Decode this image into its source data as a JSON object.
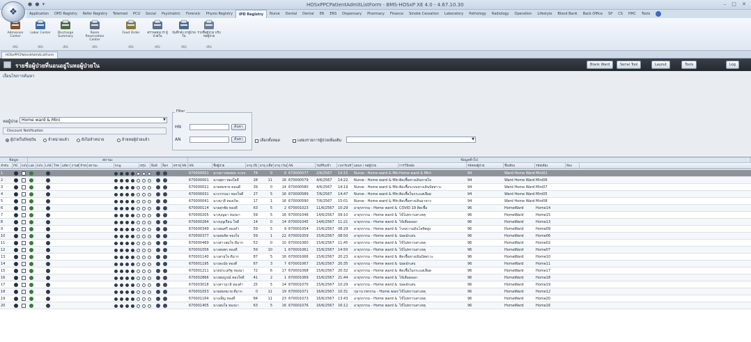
{
  "window": {
    "title": "HOSxPPCPatientAdmitListForm - BMS-HOSxP XE 4.0 - 4.67.10.30",
    "orb_symbol": "❖",
    "controls": "– □ ✕",
    "qat": "● ● ▾"
  },
  "ribbon": {
    "tabs": [
      "Application",
      "OPD Registry",
      "Refer Registry",
      "Telemed",
      "PCU",
      "Social",
      "Psychiatric",
      "Forensic",
      "Physio Registry",
      "IPD Registry",
      "Nurse",
      "Dental",
      "Dental",
      "ER",
      "ERS",
      "Dispensary",
      "Pharmacy",
      "Finance",
      "Smoke Cessation",
      "Laboratory",
      "Pathology",
      "Radiology",
      "Operation",
      "Lifestyle",
      "Blood Bank",
      "Back Office",
      "SP",
      "CS",
      "HHC",
      "Tools"
    ],
    "active_tab_index": 9,
    "buttons": [
      {
        "label": "Admission Center",
        "icon": "bed-icon",
        "group": "IPD"
      },
      {
        "label": "Labor Center",
        "icon": "labor-icon",
        "group": "IPD"
      },
      {
        "label": "Discharge Summary",
        "icon": "discharge-icon",
        "group": "IPD"
      },
      {
        "label": "Room Reservation Center",
        "icon": "room-icon",
        "group": "IPD"
      },
      {
        "label": "Food Order",
        "icon": "food-icon",
        "group": "IPD"
      },
      {
        "label": "ตรวจสอบเวร ผู้ป่วยใน",
        "icon": "check-icon",
        "group": "IPD"
      },
      {
        "label": "บันทึกสั่ง ยาผู้ป่วยใน",
        "icon": "order-icon",
        "group": "IPD"
      },
      {
        "label": "รายชื่อผู้ป่วย ปรับหอผู้ป่วย",
        "icon": "list-icon",
        "group": "IPD"
      }
    ]
  },
  "doc_tab": {
    "label": "HOSxPPCPatientAdmitListForm"
  },
  "header": {
    "title": "รายชื่อผู้ป่วยที่นอนอยู่ในหอผู้ป่วยใน",
    "buttons": [
      "Blank Ward",
      "Serial Tool",
      "Layout",
      "Tools",
      "Log"
    ]
  },
  "section_label": "เงื่อนไขการค้นหา",
  "filters": {
    "ward_label": "หอผู้ป่วย",
    "ward_value": "Home ward & Mini",
    "tools_title": "Filter",
    "hn_label": "HN",
    "an_label": "AN",
    "search_btn": "ค้นหา",
    "display_group_title": "Discount Notification",
    "radios": [
      "ผู้ป่วยในปัจจุบัน",
      "จำหน่ายแล้ว",
      "ยังไม่จำหน่าย",
      "ย้ายหอผู้ป่วยแล้ว"
    ],
    "radio_selected": 0,
    "check_label": "เลือกทั้งหมด",
    "check2_label": "แสดงรายการผู้ป่วยเพิ่มเติม"
  },
  "grid": {
    "bands": [
      {
        "label": "ข้อมูล"
      },
      {
        "label": "สถานะ"
      },
      {
        "label": "ข้อมูลทั่วไป"
      }
    ],
    "columns": [
      "ลำดับ",
      "PIC",
      "Info",
      "Lab",
      "Info",
      "LAB",
      "โรค",
      "แพ้ยา",
      "งานสังคม",
      "จำหน่าย",
      "สถานะ",
      "Img",
      "สรุป",
      "พิมพ์",
      "ล็อก",
      "ตรวจ",
      "AN",
      "HN",
      "ชื่อผู้ป่วย",
      "อายุ (ปี)",
      "อายุ (เดือน)",
      "อายุ (วัน)",
      "AN",
      "วันที่รับเข้า",
      "เวลารับเข้า",
      "แผนก / หอผู้ป่วย",
      "การวินิจฉัย",
      "รหัสหอผู้ป่วย",
      "ชื่อเตียง",
      "รหัสเตียง",
      "ห้อง"
    ],
    "rows": [
      {
        "no": "1",
        "hn": "670000001",
        "name": "นางสาวทดสอบ ระบบ",
        "y": "74",
        "m": "0",
        "d": "0",
        "an": "670000577",
        "date": "2/6/2567",
        "time": "14:15",
        "ward": "Nurse - Home ward & Mini",
        "dx": "Home ward & Mini",
        "wcode": "94",
        "bed": "Ward Home Ward",
        "bcode": "Mini01",
        "sel": true
      },
      {
        "no": "2",
        "hn": "670000001",
        "name": "นางสุดา ทองใจดี",
        "y": "28",
        "m": "11",
        "d": "16",
        "an": "670000579",
        "date": "4/6/2567",
        "time": "14:22",
        "ward": "Nurse - Home ward & Mini",
        "dx": "ติดเชื้อทางเดินหายใจ",
        "wcode": "94",
        "bed": "Ward Home Ward",
        "bcode": "Mini06"
      },
      {
        "no": "3",
        "hn": "670000021",
        "name": "นายสมชาย ดอนดี",
        "y": "39",
        "m": "0",
        "d": "14",
        "an": "670000580",
        "date": "4/6/2567",
        "time": "14:19",
        "ward": "Nurse - Home ward & Mini",
        "dx": "ติดเชื้อระบบทางเดินปัสสาวะ",
        "wcode": "94",
        "bed": "Ward Home Ward",
        "bcode": "Mini07"
      },
      {
        "no": "4",
        "hn": "670000031",
        "name": "นางวรรณา ทองใจดี",
        "y": "27",
        "m": "5",
        "d": "16",
        "an": "670000589",
        "date": "7/6/2567",
        "time": "14:47",
        "ward": "Nurse - Home ward & Mini",
        "dx": "ติดเชื้อในกระแสเลือด",
        "wcode": "94",
        "bed": "Ward Home Ward",
        "bcode": "Mini05"
      },
      {
        "no": "5",
        "hn": "670000041",
        "name": "นางมาลี ทองเกิด",
        "y": "17",
        "m": "1",
        "d": "16",
        "an": "670000590",
        "date": "7/6/2567",
        "time": "15:01",
        "ward": "Nurse - Home ward & Mini",
        "dx": "ติดเชื้อทางเดินอาหาร",
        "wcode": "94",
        "bed": "Ward Home Ward",
        "bcode": "Mini08"
      },
      {
        "no": "6",
        "hn": "670000114",
        "name": "นายสุรชัย ทองดี",
        "y": "63",
        "m": "5",
        "d": "2",
        "an": "670001023",
        "date": "11/6/2567",
        "time": "10:29",
        "ward": "อายุรกรรม - Home ward & Mini",
        "dx": "COVID 19 ติดเชื้อ",
        "wcode": "96",
        "bed": "HomeWard",
        "bcode": "Home14"
      },
      {
        "no": "7",
        "hn": "670000205",
        "name": "นางบุญมา ทองมา",
        "y": "59",
        "m": "5",
        "d": "16",
        "an": "670001046",
        "date": "14/6/2567",
        "time": "09:10",
        "ward": "อายุรกรรม - Home ward & Mini",
        "dx": "ไข้ไม่ทราบสาเหตุ",
        "wcode": "96",
        "bed": "HomeWard",
        "bcode": "Home15"
      },
      {
        "no": "8",
        "hn": "670000264",
        "name": "นางบุญเรือน ใจดี",
        "y": "14",
        "m": "0",
        "d": "14",
        "an": "670001045",
        "date": "14/6/2567",
        "time": "11:21",
        "ward": "อายุรกรรม - Home ward & Mini",
        "dx": "ไข้เลือดออก",
        "wcode": "96",
        "bed": "HomeWard",
        "bcode": "Home13"
      },
      {
        "no": "9",
        "hn": "670000349",
        "name": "นางสมศรี ทองคำ",
        "y": "59",
        "m": "5",
        "d": "9",
        "an": "670001054",
        "date": "15/6/2567",
        "time": "08:29",
        "ward": "อายุรกรรม - Home ward & Mini",
        "dx": "โรคความดันโลหิตสูง",
        "wcode": "96",
        "bed": "HomeWard",
        "bcode": "Home09"
      },
      {
        "no": "10",
        "hn": "670000377",
        "name": "นายสมจิต ทองใจ",
        "y": "59",
        "m": "1",
        "d": "22",
        "an": "670001059",
        "date": "15/6/2567",
        "time": "08:50",
        "ward": "อายุรกรรม - Home ward & Mini",
        "dx": "ปอดอักเสบ",
        "wcode": "96",
        "bed": "HomeWard",
        "bcode": "Home06"
      },
      {
        "no": "11",
        "hn": "670000469",
        "name": "นางสาวสมใจ ดีมาก",
        "y": "53",
        "m": "0",
        "d": "10",
        "an": "670001060",
        "date": "15/6/2567",
        "time": "11:45",
        "ward": "อายุรกรรม - Home ward & Mini",
        "dx": "ไข้ไม่ทราบสาเหตุ",
        "wcode": "96",
        "bed": "HomeWard",
        "bcode": "Home02"
      },
      {
        "no": "12",
        "hn": "670001056",
        "name": "นางสมพร ทองดี",
        "y": "59",
        "m": "10",
        "d": "1",
        "an": "670001061",
        "date": "15/6/2567",
        "time": "14:50",
        "ward": "อายุรกรรม - Home ward & Mini",
        "dx": "ไข้ไม่ทราบสาเหตุ",
        "wcode": "96",
        "bed": "HomeWard",
        "bcode": "Home07"
      },
      {
        "no": "13",
        "hn": "670001140",
        "name": "นางสายใจ ดีมาก",
        "y": "87",
        "m": "5",
        "d": "16",
        "an": "670001066",
        "date": "15/6/2567",
        "time": "20:23",
        "ward": "อายุรกรรม - Home ward & Mini",
        "dx": "ติดเชื้อทางเดินปัสสาวะ",
        "wcode": "96",
        "bed": "HomeWard",
        "bcode": "Home10"
      },
      {
        "no": "14",
        "hn": "670001195",
        "name": "นางละมัย ทองดี",
        "y": "67",
        "m": "3",
        "d": "7",
        "an": "670001067",
        "date": "15/6/2567",
        "time": "20:35",
        "ward": "อายุรกรรม - Home ward & Mini",
        "dx": "ปอดอักเสบ",
        "wcode": "96",
        "bed": "HomeWard",
        "bcode": "Home11"
      },
      {
        "no": "15",
        "hn": "670001211",
        "name": "นายประเสริฐ ทองมา",
        "y": "72",
        "m": "6",
        "d": "17",
        "an": "670001068",
        "date": "15/6/2567",
        "time": "20:32",
        "ward": "อายุรกรรม - Home ward & Mini",
        "dx": "ติดเชื้อในกระแสเลือด",
        "wcode": "96",
        "bed": "HomeWard",
        "bcode": "Home17"
      },
      {
        "no": "16",
        "hn": "670002866",
        "name": "นางสมบูรณ์ ทองใจดี",
        "y": "41",
        "m": "2",
        "d": "1",
        "an": "670001069",
        "date": "15/6/2567",
        "time": "21:44",
        "ward": "อายุรกรรม - Home ward & Mini",
        "dx": "ไข้เลือดออก",
        "wcode": "96",
        "bed": "HomeWard",
        "bcode": "Home18"
      },
      {
        "no": "17",
        "hn": "670003018",
        "name": "นางสาวมาลี ทองคำ",
        "y": "25",
        "m": "5",
        "d": "14",
        "an": "670001070",
        "date": "15/6/2567",
        "time": "10:29",
        "ward": "อายุรกรรม - Home ward & Mini",
        "dx": "ปอดอักเสบ",
        "wcode": "96",
        "bed": "HomeWard",
        "bcode": "Home19"
      },
      {
        "no": "18",
        "hn": "670001053",
        "name": "นายสมหมาย ดีมาก",
        "y": "0",
        "m": "11",
        "d": "19",
        "an": "670001071",
        "date": "16/6/2567",
        "time": "10:31",
        "ward": "กุมารเวชกรรม - Home ward & Mini",
        "dx": "ไข้ไม่ทราบสาเหตุ",
        "wcode": "96",
        "bed": "HomeWard",
        "bcode": "Home12"
      },
      {
        "no": "19",
        "hn": "670001164",
        "name": "นางเพ็ญ ทองดี",
        "y": "84",
        "m": "11",
        "d": "23",
        "an": "670001073",
        "date": "16/6/2567",
        "time": "13:43",
        "ward": "อายุรกรรม - Home ward & Mini",
        "dx": "ไข้ไม่ทราบสาเหตุ",
        "wcode": "96",
        "bed": "HomeWard",
        "bcode": "Home20"
      },
      {
        "no": "20",
        "hn": "670001405",
        "name": "นางสมใจ ทองมา",
        "y": "63",
        "m": "5",
        "d": "16",
        "an": "670001076",
        "date": "16/6/2567",
        "time": "16:12",
        "ward": "อายุรกรรม - Home ward & Mini",
        "dx": "ไข้ไม่ทราบสาเหตุ",
        "wcode": "96",
        "bed": "HomeWard",
        "bcode": "Home16"
      }
    ]
  },
  "colors": {
    "header_bg": "#2b3036",
    "selected_row": "#8e9299",
    "accent": "#3a6bc2"
  }
}
